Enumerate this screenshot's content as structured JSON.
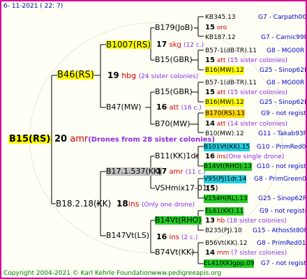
{
  "header": {
    "date": "6- 11-2021 ( 22: 7)"
  },
  "root": {
    "name": "B15(RS)",
    "num": "20",
    "abbr": "amr",
    "annotation": "(Drones from 28 sister colonies)"
  },
  "father": {
    "name": "B46(RS)",
    "num": "19",
    "abbr": "hbg",
    "annotation": "(24 sister colonies)"
  },
  "mother": {
    "name": "B18.2.18(KK)",
    "num": "18",
    "abbr": "ins",
    "annotation": "(Only one drone)"
  },
  "ff": {
    "name": "B1007(RS)"
  },
  "fm": {
    "name": "B47(MW)",
    "num": "16",
    "abbr": "att",
    "annotation": "(16 c.)"
  },
  "mf": {
    "name": "B17.1.537(KK)",
    "num": "17",
    "abbr": "amr",
    "annotation": "(11 c.)"
  },
  "mm": {
    "name": "B147Vt(LS)",
    "num": "16",
    "abbr": "ins",
    "annotation": "(2 c.)"
  },
  "fff": {
    "name": "B179(JoB)",
    "num": "17",
    "abbr": "skg",
    "annotation": "(12 c.)"
  },
  "ffm": {
    "name": "B15(GBR)"
  },
  "fmf": {
    "name": "B15(GBR)"
  },
  "fmm": {
    "name": "B70(MW)"
  },
  "mff": {
    "name": "B11(KK)1dr"
  },
  "mfm": {
    "name": "VSHmix17-01(S)"
  },
  "mmf": {
    "name": "B14Vt(RHO)",
    "num": "16",
    "abbr": "ins",
    "annotation": "(2 c.)"
  },
  "mmm": {
    "name": "B74Vt(KK)"
  },
  "gen4": [
    {
      "name": "KB345.13",
      "gen": "G7 - Carpath00R"
    },
    {
      "line": true,
      "num": "15",
      "abbr": "oro"
    },
    {
      "name": "KB187.12",
      "gen": "G7 - Carnic99R"
    },
    {
      "name": "B57-1(dB-TR).11",
      "gen": "G8 - MG00R"
    },
    {
      "line": true,
      "num": "15",
      "abbr": "att",
      "annotation": "(15 sister colonies)"
    },
    {
      "name": "B16(MW).12",
      "gen": "G25 - Sinop62R"
    },
    {
      "name": "B57-1(dB-TR).11",
      "gen": "G8 - MG00R"
    },
    {
      "line": true,
      "num": "15",
      "abbr": "att",
      "annotation": "(15 sister colonies)"
    },
    {
      "name": "B16(MW).12",
      "gen": "G25 - Sinop62R"
    },
    {
      "name": "B170(RS).13",
      "gen": "G9 - not registe"
    },
    {
      "line": true,
      "num": "14",
      "abbr": "att",
      "annotation": "(14 sister colonies)"
    },
    {
      "name": "B10(MW).12",
      "gen": "G11 - Takab93R"
    },
    {
      "name": "B101Vt(KK).15",
      "gen": "G10 - PrimRed01"
    },
    {
      "line": true,
      "num": "16",
      "abbr": "ins",
      "annotation": "(One single drone)"
    },
    {
      "name": "B14Vt(RHO).13",
      "gen": "G10 - not registe"
    },
    {
      "name": "V95(PJ)1dr.14",
      "gen": "G8 - PrimGreen00"
    },
    {
      "line": true,
      "num": "15",
      "abbr": "",
      "annotation": ""
    },
    {
      "name": "V154H(RL).13",
      "gen": "G25 - Sinop62R"
    },
    {
      "name": "EL61(KK).11",
      "gen": "G9 - not registe"
    },
    {
      "line": true,
      "num": "13",
      "abbr": "hb",
      "annotation": "(18 sister colonies)"
    },
    {
      "name": "B235(PJ).10",
      "gen": "G15 - AthosSt80R"
    },
    {
      "name": "B56Vt(KK).12",
      "gen": "G8 - PrimRed01"
    },
    {
      "line": true,
      "num": "14",
      "abbr": "mm",
      "annotation": "(7 sister colonies)"
    },
    {
      "name": "EL41(KK)gpp.09",
      "gen": "G7 - not registe"
    }
  ],
  "footer": {
    "copyright": "Copyright 2004-2021 © Karl Kehrle Foundation",
    "site": "www.pedigreeapis.org"
  },
  "colors": {
    "border": "#d4009a",
    "highlight_yellow": "#ffff00",
    "highlight_green": "#22cc22",
    "highlight_cyan": "#22ccdd",
    "highlight_gray": "#bfbfbf",
    "red_text": "#cc0000",
    "annotation_text": "#8a2be2",
    "blue_text": "#0000cc"
  }
}
